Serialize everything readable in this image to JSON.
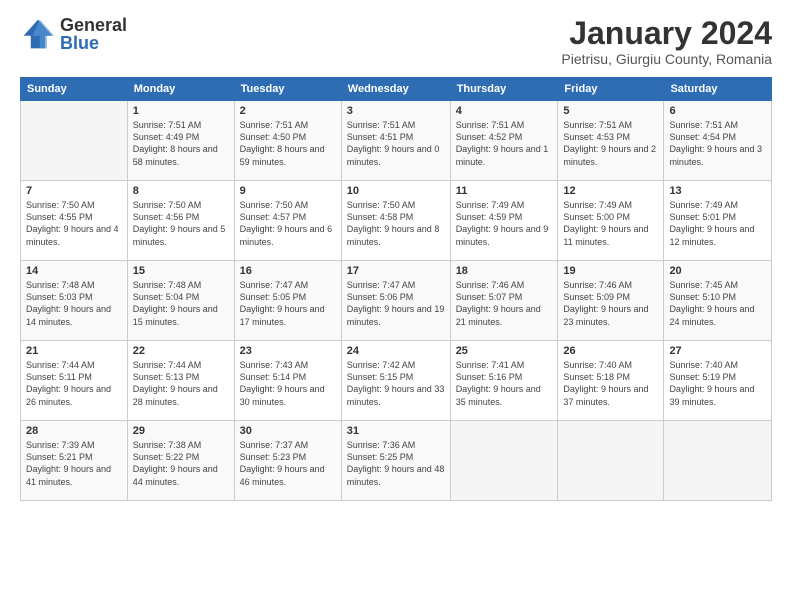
{
  "logo": {
    "general": "General",
    "blue": "Blue"
  },
  "header": {
    "title": "January 2024",
    "subtitle": "Pietrisu, Giurgiu County, Romania"
  },
  "weekdays": [
    "Sunday",
    "Monday",
    "Tuesday",
    "Wednesday",
    "Thursday",
    "Friday",
    "Saturday"
  ],
  "weeks": [
    [
      {
        "day": "",
        "sunrise": "",
        "sunset": "",
        "daylight": ""
      },
      {
        "day": "1",
        "sunrise": "Sunrise: 7:51 AM",
        "sunset": "Sunset: 4:49 PM",
        "daylight": "Daylight: 8 hours and 58 minutes."
      },
      {
        "day": "2",
        "sunrise": "Sunrise: 7:51 AM",
        "sunset": "Sunset: 4:50 PM",
        "daylight": "Daylight: 8 hours and 59 minutes."
      },
      {
        "day": "3",
        "sunrise": "Sunrise: 7:51 AM",
        "sunset": "Sunset: 4:51 PM",
        "daylight": "Daylight: 9 hours and 0 minutes."
      },
      {
        "day": "4",
        "sunrise": "Sunrise: 7:51 AM",
        "sunset": "Sunset: 4:52 PM",
        "daylight": "Daylight: 9 hours and 1 minute."
      },
      {
        "day": "5",
        "sunrise": "Sunrise: 7:51 AM",
        "sunset": "Sunset: 4:53 PM",
        "daylight": "Daylight: 9 hours and 2 minutes."
      },
      {
        "day": "6",
        "sunrise": "Sunrise: 7:51 AM",
        "sunset": "Sunset: 4:54 PM",
        "daylight": "Daylight: 9 hours and 3 minutes."
      }
    ],
    [
      {
        "day": "7",
        "sunrise": "Sunrise: 7:50 AM",
        "sunset": "Sunset: 4:55 PM",
        "daylight": "Daylight: 9 hours and 4 minutes."
      },
      {
        "day": "8",
        "sunrise": "Sunrise: 7:50 AM",
        "sunset": "Sunset: 4:56 PM",
        "daylight": "Daylight: 9 hours and 5 minutes."
      },
      {
        "day": "9",
        "sunrise": "Sunrise: 7:50 AM",
        "sunset": "Sunset: 4:57 PM",
        "daylight": "Daylight: 9 hours and 6 minutes."
      },
      {
        "day": "10",
        "sunrise": "Sunrise: 7:50 AM",
        "sunset": "Sunset: 4:58 PM",
        "daylight": "Daylight: 9 hours and 8 minutes."
      },
      {
        "day": "11",
        "sunrise": "Sunrise: 7:49 AM",
        "sunset": "Sunset: 4:59 PM",
        "daylight": "Daylight: 9 hours and 9 minutes."
      },
      {
        "day": "12",
        "sunrise": "Sunrise: 7:49 AM",
        "sunset": "Sunset: 5:00 PM",
        "daylight": "Daylight: 9 hours and 11 minutes."
      },
      {
        "day": "13",
        "sunrise": "Sunrise: 7:49 AM",
        "sunset": "Sunset: 5:01 PM",
        "daylight": "Daylight: 9 hours and 12 minutes."
      }
    ],
    [
      {
        "day": "14",
        "sunrise": "Sunrise: 7:48 AM",
        "sunset": "Sunset: 5:03 PM",
        "daylight": "Daylight: 9 hours and 14 minutes."
      },
      {
        "day": "15",
        "sunrise": "Sunrise: 7:48 AM",
        "sunset": "Sunset: 5:04 PM",
        "daylight": "Daylight: 9 hours and 15 minutes."
      },
      {
        "day": "16",
        "sunrise": "Sunrise: 7:47 AM",
        "sunset": "Sunset: 5:05 PM",
        "daylight": "Daylight: 9 hours and 17 minutes."
      },
      {
        "day": "17",
        "sunrise": "Sunrise: 7:47 AM",
        "sunset": "Sunset: 5:06 PM",
        "daylight": "Daylight: 9 hours and 19 minutes."
      },
      {
        "day": "18",
        "sunrise": "Sunrise: 7:46 AM",
        "sunset": "Sunset: 5:07 PM",
        "daylight": "Daylight: 9 hours and 21 minutes."
      },
      {
        "day": "19",
        "sunrise": "Sunrise: 7:46 AM",
        "sunset": "Sunset: 5:09 PM",
        "daylight": "Daylight: 9 hours and 23 minutes."
      },
      {
        "day": "20",
        "sunrise": "Sunrise: 7:45 AM",
        "sunset": "Sunset: 5:10 PM",
        "daylight": "Daylight: 9 hours and 24 minutes."
      }
    ],
    [
      {
        "day": "21",
        "sunrise": "Sunrise: 7:44 AM",
        "sunset": "Sunset: 5:11 PM",
        "daylight": "Daylight: 9 hours and 26 minutes."
      },
      {
        "day": "22",
        "sunrise": "Sunrise: 7:44 AM",
        "sunset": "Sunset: 5:13 PM",
        "daylight": "Daylight: 9 hours and 28 minutes."
      },
      {
        "day": "23",
        "sunrise": "Sunrise: 7:43 AM",
        "sunset": "Sunset: 5:14 PM",
        "daylight": "Daylight: 9 hours and 30 minutes."
      },
      {
        "day": "24",
        "sunrise": "Sunrise: 7:42 AM",
        "sunset": "Sunset: 5:15 PM",
        "daylight": "Daylight: 9 hours and 33 minutes."
      },
      {
        "day": "25",
        "sunrise": "Sunrise: 7:41 AM",
        "sunset": "Sunset: 5:16 PM",
        "daylight": "Daylight: 9 hours and 35 minutes."
      },
      {
        "day": "26",
        "sunrise": "Sunrise: 7:40 AM",
        "sunset": "Sunset: 5:18 PM",
        "daylight": "Daylight: 9 hours and 37 minutes."
      },
      {
        "day": "27",
        "sunrise": "Sunrise: 7:40 AM",
        "sunset": "Sunset: 5:19 PM",
        "daylight": "Daylight: 9 hours and 39 minutes."
      }
    ],
    [
      {
        "day": "28",
        "sunrise": "Sunrise: 7:39 AM",
        "sunset": "Sunset: 5:21 PM",
        "daylight": "Daylight: 9 hours and 41 minutes."
      },
      {
        "day": "29",
        "sunrise": "Sunrise: 7:38 AM",
        "sunset": "Sunset: 5:22 PM",
        "daylight": "Daylight: 9 hours and 44 minutes."
      },
      {
        "day": "30",
        "sunrise": "Sunrise: 7:37 AM",
        "sunset": "Sunset: 5:23 PM",
        "daylight": "Daylight: 9 hours and 46 minutes."
      },
      {
        "day": "31",
        "sunrise": "Sunrise: 7:36 AM",
        "sunset": "Sunset: 5:25 PM",
        "daylight": "Daylight: 9 hours and 48 minutes."
      },
      {
        "day": "",
        "sunrise": "",
        "sunset": "",
        "daylight": ""
      },
      {
        "day": "",
        "sunrise": "",
        "sunset": "",
        "daylight": ""
      },
      {
        "day": "",
        "sunrise": "",
        "sunset": "",
        "daylight": ""
      }
    ]
  ]
}
